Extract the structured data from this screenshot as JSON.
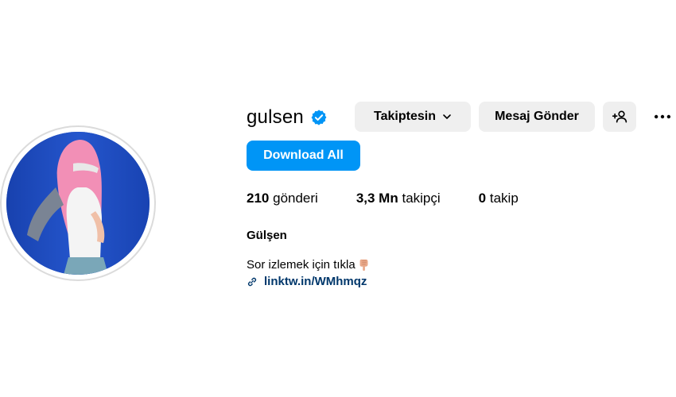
{
  "profile": {
    "username": "gulsen",
    "full_name": "Gülşen",
    "bio": "Sor izlemek için tıkla",
    "bio_emoji": "pointing-down-hand",
    "link_text": "linktw.in/WMhmqz"
  },
  "actions": {
    "follow_label": "Takiptesin",
    "message_label": "Mesaj Gönder",
    "download_label": "Download All"
  },
  "stats": {
    "posts_count": "210",
    "posts_label": "gönderi",
    "followers_count": "3,3 Mn",
    "followers_label": "takipçi",
    "following_count": "0",
    "following_label": "takip"
  },
  "colors": {
    "accent": "#0095f6",
    "verified": "#0095f6",
    "button_bg": "#efefef",
    "link": "#00376b"
  },
  "icons": [
    "verified-badge-icon",
    "chevron-down-icon",
    "add-user-icon",
    "more-options-icon",
    "link-icon"
  ]
}
